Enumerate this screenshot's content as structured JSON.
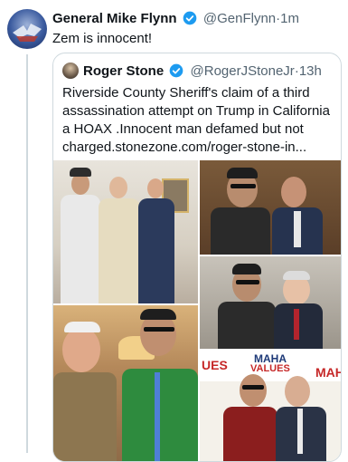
{
  "tweet": {
    "author_name": "General Mike Flynn",
    "author_handle": "@GenFlynn",
    "separator": "·",
    "time": "1m",
    "text": "Zem is innocent!"
  },
  "quote": {
    "author_name": "Roger Stone",
    "author_handle": "@RogerJStoneJr",
    "separator": "·",
    "time": "13h",
    "text": "Riverside County Sheriff's  claim of a third assassination attempt on Trump in California a HOAX .Innocent man defamed but not charged.stonezone.com/roger-stone-in..."
  },
  "photos": {
    "banner_top": "MAHA",
    "banner_left": "UES",
    "banner_sub": "VALUES",
    "banner_right": "MAH"
  },
  "colors": {
    "verified": "#1d9bf0",
    "muted": "#536471",
    "border": "#cfd9de"
  }
}
